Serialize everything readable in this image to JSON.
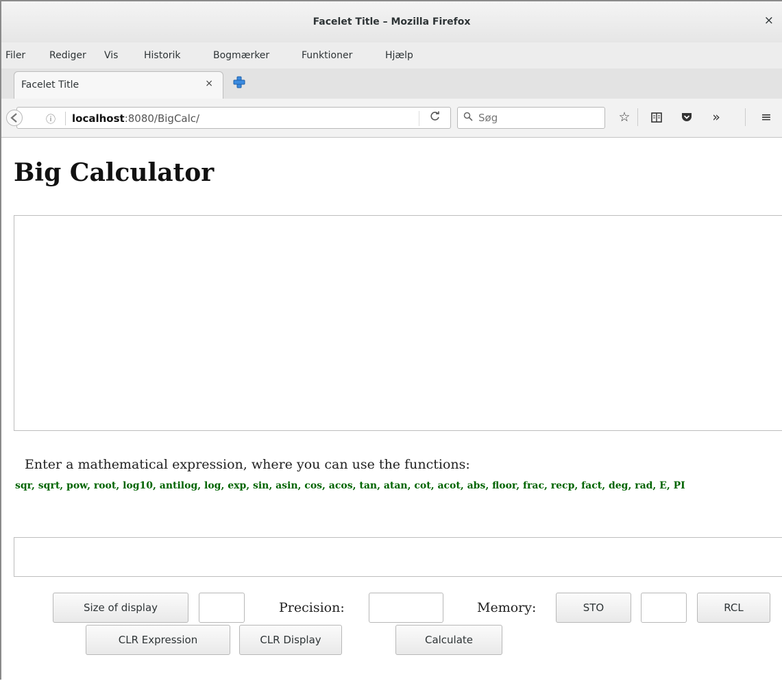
{
  "window": {
    "title": "Facelet Title – Mozilla Firefox",
    "close": "×"
  },
  "menu": [
    "Filer",
    "Rediger",
    "Vis",
    "Historik",
    "Bogmærker",
    "Funktioner",
    "Hjælp"
  ],
  "tab": {
    "label": "Facelet Title",
    "close": "×"
  },
  "nav": {
    "info": "ⓘ",
    "url_host": "localhost",
    "url_rest": ":8080/BigCalc/",
    "reload": "C",
    "search_placeholder": "Søg",
    "icons": [
      "star-icon",
      "reading-list-icon",
      "pocket-icon",
      "overflow-icon",
      "menu-icon"
    ]
  },
  "page": {
    "title": "Big Calculator",
    "instruction": "Enter a mathematical expression, where you can use the functions:",
    "functions": "sqr, sqrt, pow, root, log10, antilog, log, exp, sin, asin, cos, acos, tan, atan, cot, acot, abs, floor, frac, recp, fact, deg, rad, E, PI",
    "display_value": "",
    "expression_value": ""
  },
  "controls": {
    "size_button": "Size of display",
    "size_value": "",
    "precision_label": "Precision:",
    "precision_value": "",
    "memory_label": "Memory:",
    "sto_button": "STO",
    "memory_value": "",
    "rcl_button": "RCL",
    "clr_expression": "CLR Expression",
    "clr_display": "CLR Display",
    "calculate": "Calculate"
  },
  "colors": {
    "functions_text": "#006400",
    "chrome": "#ededed"
  }
}
